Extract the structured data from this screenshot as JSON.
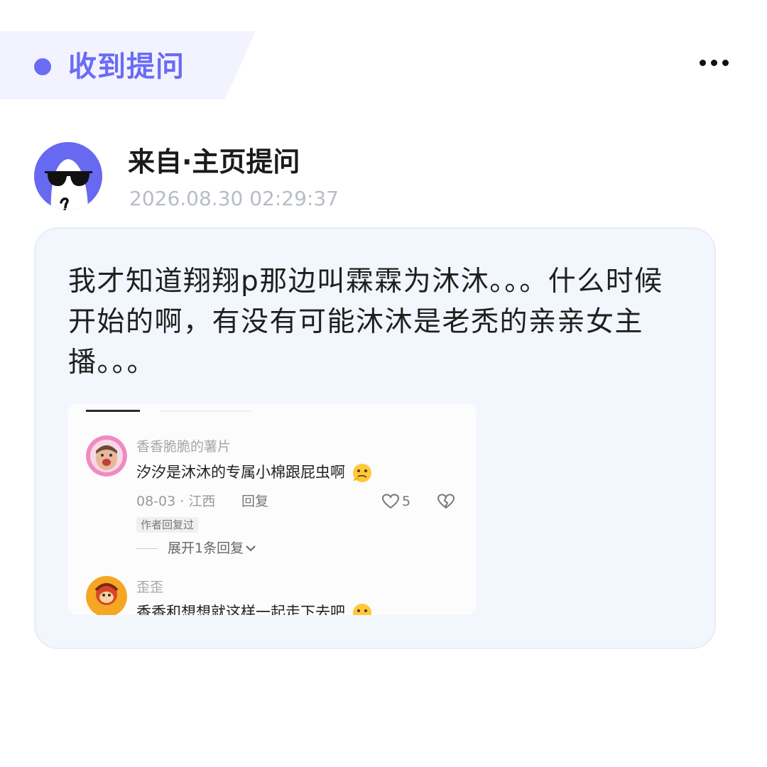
{
  "header": {
    "title": "收到提问"
  },
  "sender": {
    "name": "来自·主页提问",
    "time": "2026.08.30 02:29:37"
  },
  "question": {
    "text": "我才知道翔翔p那边叫霖霖为沐沐。。。什么时候开始的啊，有没有可能沐沐是老秃的亲亲女主播。。。"
  },
  "screenshot": {
    "comments": [
      {
        "user": "香香脆脆的薯片",
        "text": "汐汐是沐沐的专属小棉跟屁虫啊",
        "date": "08-03",
        "sep": "·",
        "location": "江西",
        "reply_label": "回复",
        "likes": "5",
        "badge": "作者回复过",
        "expand": "展开1条回复"
      },
      {
        "user": "歪歪",
        "text": "香香和想想就这样一起走下去吧"
      }
    ]
  },
  "colors": {
    "accent": "#6a6cf6",
    "card_bg": "#f2f6fd"
  },
  "icons": [
    "more-icon",
    "avatar-sunglasses",
    "heart-icon",
    "broken-heart-icon",
    "chevron-down-icon",
    "emoji-icon"
  ]
}
